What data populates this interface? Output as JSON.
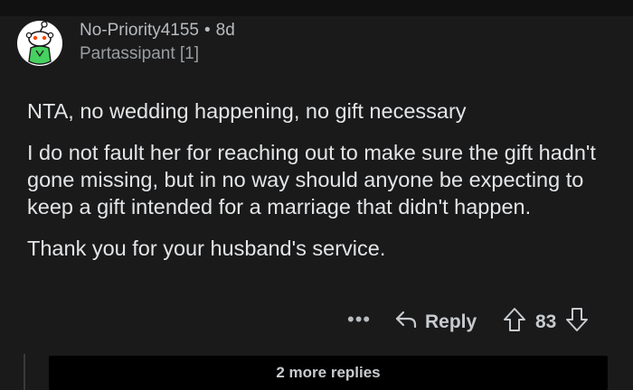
{
  "comment": {
    "username": "No-Priority4155",
    "separator": "•",
    "age": "8d",
    "flair": "Partassipant [1]",
    "paragraphs": [
      "NTA, no wedding happening, no gift necessary",
      "I do not fault her for reaching out to make sure the gift hadn't gone missing, but in no way should anyone be expecting to keep a gift intended for a marriage that didn't happen.",
      "Thank you for your husband's service."
    ]
  },
  "actions": {
    "more_label": "•••",
    "reply_label": "Reply",
    "score": "83"
  },
  "more_replies_label": "2 more replies",
  "colors": {
    "background": "#1a1a1b",
    "text": "#d7dadc",
    "avatar_green": "#46d160",
    "reddit_orange": "#ff4500"
  },
  "icons": [
    "snoo-avatar-icon",
    "reply-arrow-icon",
    "upvote-arrow-icon",
    "downvote-arrow-icon",
    "more-options-icon"
  ]
}
